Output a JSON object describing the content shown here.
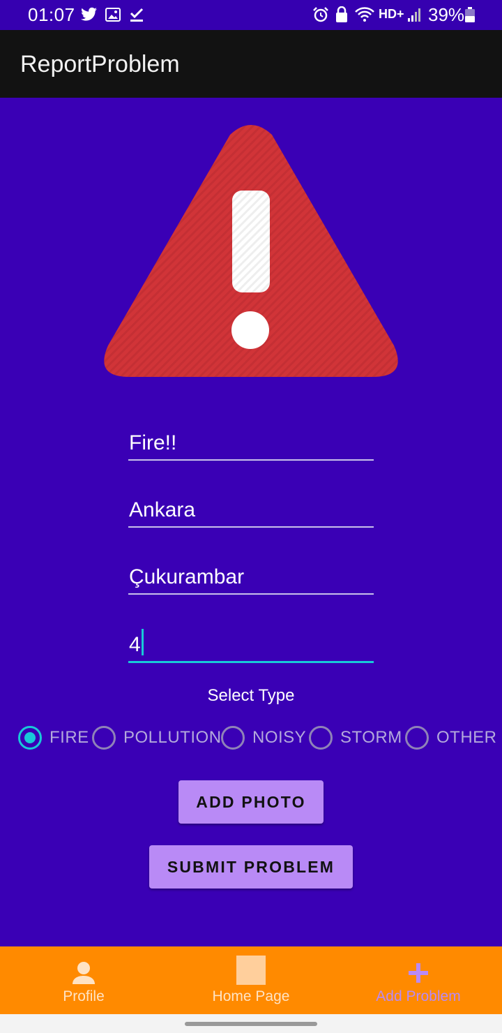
{
  "status_bar": {
    "time": "01:07",
    "network": "HD+",
    "battery": "39%",
    "icons": [
      "twitter-icon",
      "image-icon",
      "download-done-icon",
      "alarm-icon",
      "lock-icon",
      "wifi-icon",
      "signal-icon",
      "battery-icon"
    ]
  },
  "app_bar": {
    "title": "ReportProblem"
  },
  "warning": {
    "icon": "warning-triangle-icon",
    "color": "#d13438"
  },
  "form": {
    "fields": [
      {
        "name": "title-field",
        "value": "Fire!!"
      },
      {
        "name": "city-field",
        "value": "Ankara"
      },
      {
        "name": "district-field",
        "value": "Çukurambar"
      },
      {
        "name": "number-field",
        "value": "4"
      }
    ],
    "select_type_label": "Select Type",
    "types": [
      {
        "label": "FIRE",
        "checked": true
      },
      {
        "label": "POLLUTION",
        "checked": false
      },
      {
        "label": "NOISY",
        "checked": false
      },
      {
        "label": "STORM",
        "checked": false
      },
      {
        "label": "OTHER",
        "checked": false
      }
    ],
    "add_photo_label": "ADD PHOTO",
    "submit_label": "SUBMIT PROBLEM"
  },
  "bottom_nav": {
    "items": [
      {
        "label": "Profile",
        "icon": "person-icon"
      },
      {
        "label": "Home Page",
        "icon": "home-square-icon"
      },
      {
        "label": "Add Problem",
        "icon": "plus-icon",
        "selected": true
      }
    ]
  },
  "colors": {
    "background": "#3a00b5",
    "app_bar": "#121212",
    "accent": "#18c9d8",
    "button": "#b98af6",
    "bottom_nav": "#ff8a00",
    "selected_nav": "#b98af6"
  }
}
